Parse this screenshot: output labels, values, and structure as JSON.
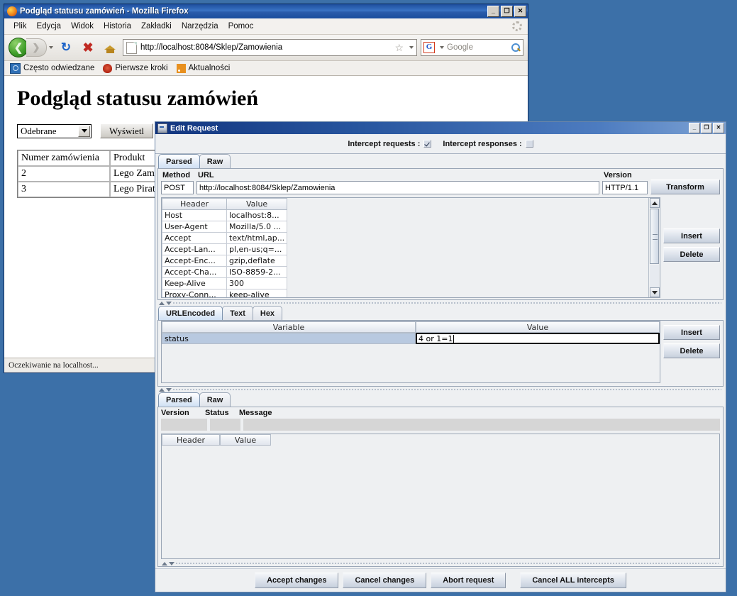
{
  "desktop": {
    "background_color": "#3c70a8"
  },
  "firefox": {
    "title": "Podgląd statusu zamówień - Mozilla Firefox",
    "window_controls": {
      "minimize": "_",
      "maximize": "❐",
      "close": "✕"
    },
    "menu": [
      "Plik",
      "Edycja",
      "Widok",
      "Historia",
      "Zakładki",
      "Narzędzia",
      "Pomoc"
    ],
    "toolbar": {
      "back_icon": "back-arrow-icon",
      "forward_icon": "forward-arrow-icon",
      "reload_icon": "reload-icon",
      "stop_icon": "stop-icon",
      "home_icon": "home-icon",
      "url": "http://localhost:8084/Sklep/Zamowienia",
      "bookmark_star": "☆",
      "search_engine": "G",
      "search_placeholder": "Google",
      "search_icon": "magnifier-icon"
    },
    "bookmarks": [
      {
        "label": "Często odwiedzane",
        "icon": "most-visited-icon"
      },
      {
        "label": "Pierwsze kroki",
        "icon": "getting-started-icon"
      },
      {
        "label": "Aktualności",
        "icon": "latest-headlines-icon"
      }
    ],
    "page": {
      "heading": "Podgląd statusu zamówień",
      "select_value": "Odebrane",
      "submit_label": "Wyświetl",
      "table": {
        "headers": [
          "Numer zamówienia",
          "Produkt"
        ],
        "rows": [
          [
            "2",
            "Lego Zamek"
          ],
          [
            "3",
            "Lego Pirat"
          ]
        ]
      }
    },
    "statusbar": "Oczekiwanie na localhost..."
  },
  "edit_request": {
    "title": "Edit Request",
    "window_controls": {
      "minimize": "_",
      "maximize": "❐",
      "close": "✕"
    },
    "intercept": {
      "requests_label": "Intercept requests :",
      "requests_checked": true,
      "responses_label": "Intercept responses :",
      "responses_checked": false
    },
    "request_tabs": [
      {
        "label": "Parsed",
        "active": true
      },
      {
        "label": "Raw",
        "active": false
      }
    ],
    "request_line": {
      "method_label": "Method",
      "method_value": "POST",
      "url_label": "URL",
      "url_value": "http://localhost:8084/Sklep/Zamowienia",
      "version_label": "Version",
      "version_value": "HTTP/1.1",
      "transform_label": "Transform"
    },
    "headers_table": {
      "columns": [
        "Header",
        "Value"
      ],
      "rows": [
        [
          "Host",
          "localhost:8..."
        ],
        [
          "User-Agent",
          "Mozilla/5.0 ..."
        ],
        [
          "Accept",
          "text/html,ap..."
        ],
        [
          "Accept-Lan...",
          "pl,en-us;q=..."
        ],
        [
          "Accept-Enc...",
          "gzip,deflate"
        ],
        [
          "Accept-Cha...",
          "ISO-8859-2..."
        ],
        [
          "Keep-Alive",
          "300"
        ],
        [
          "Proxy-Conn...",
          "keep-alive"
        ]
      ]
    },
    "headers_buttons": {
      "insert": "Insert",
      "delete": "Delete"
    },
    "body_tabs": [
      {
        "label": "URLEncoded",
        "active": true
      },
      {
        "label": "Text",
        "active": false
      },
      {
        "label": "Hex",
        "active": false
      }
    ],
    "body_table": {
      "columns": [
        "Variable",
        "Value"
      ],
      "rows": [
        {
          "variable": "status",
          "value": "4 or 1=1",
          "editing": true,
          "selected": true
        }
      ]
    },
    "body_buttons": {
      "insert": "Insert",
      "delete": "Delete"
    },
    "response_tabs": [
      {
        "label": "Parsed",
        "active": true
      },
      {
        "label": "Raw",
        "active": false
      }
    ],
    "response_status": {
      "version_label": "Version",
      "status_label": "Status",
      "message_label": "Message",
      "version_value": "",
      "status_value": "",
      "message_value": ""
    },
    "response_headers_table": {
      "columns": [
        "Header",
        "Value"
      ],
      "rows": []
    },
    "buttons": {
      "accept": "Accept changes",
      "cancel": "Cancel changes",
      "abort": "Abort request",
      "cancel_all": "Cancel ALL intercepts"
    }
  }
}
